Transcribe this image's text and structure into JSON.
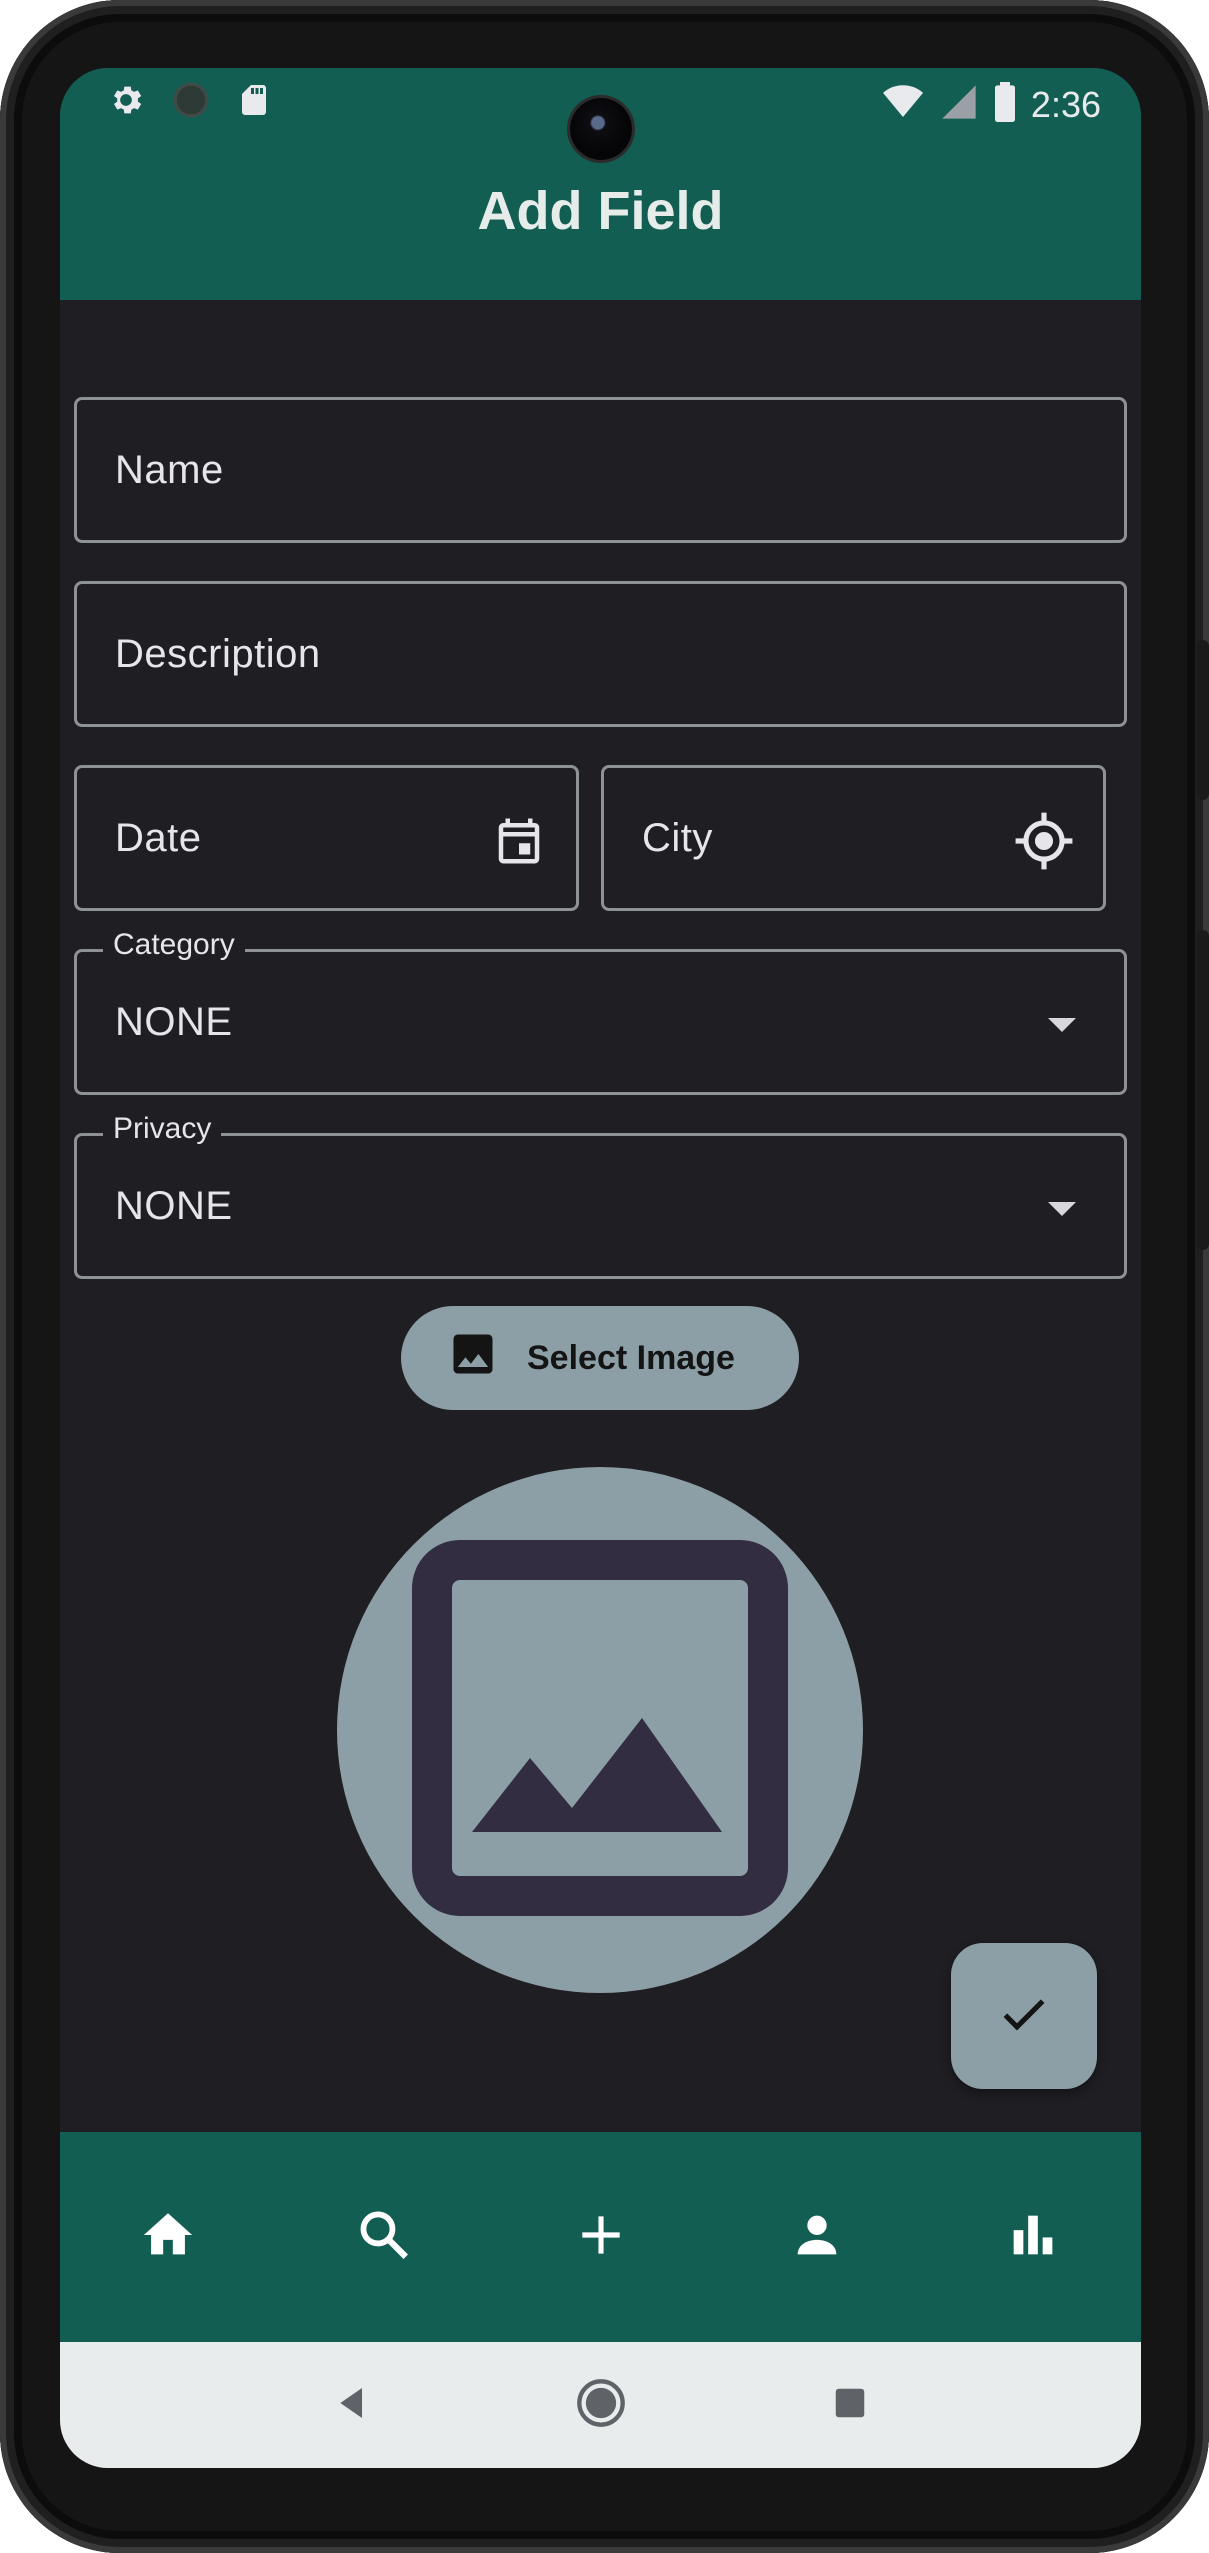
{
  "status_bar": {
    "time": "2:36",
    "left_icons": [
      "settings-icon",
      "circle-icon",
      "sd-card-icon"
    ],
    "right_icons": [
      "wifi-icon",
      "signal-icon",
      "battery-icon"
    ]
  },
  "app_bar": {
    "title": "Add Field"
  },
  "form": {
    "name": {
      "label": "Name",
      "value": ""
    },
    "description": {
      "label": "Description",
      "value": ""
    },
    "date": {
      "label": "Date",
      "icon": "calendar-icon",
      "value": ""
    },
    "city": {
      "label": "City",
      "icon": "my-location-icon",
      "value": ""
    },
    "category": {
      "label": "Category",
      "value": "NONE"
    },
    "privacy": {
      "label": "Privacy",
      "value": "NONE"
    }
  },
  "select_image_button": {
    "label": "Select Image",
    "icon": "image-icon"
  },
  "image_preview": {
    "icon": "image-placeholder-icon"
  },
  "fab": {
    "icon": "check-icon"
  },
  "bottom_nav": {
    "items": [
      {
        "name": "home",
        "icon": "home-icon"
      },
      {
        "name": "search",
        "icon": "search-icon"
      },
      {
        "name": "add",
        "icon": "add-icon"
      },
      {
        "name": "profile",
        "icon": "person-icon"
      },
      {
        "name": "stats",
        "icon": "bar-chart-icon"
      }
    ]
  },
  "system_nav": {
    "items": [
      "back-icon",
      "home-circle-icon",
      "recents-icon"
    ]
  },
  "colors": {
    "primary": "#135e53",
    "background": "#1f1e23",
    "surface_accent": "#8d9fa6",
    "image_icon": "#332d41",
    "outline": "#8e9296"
  }
}
